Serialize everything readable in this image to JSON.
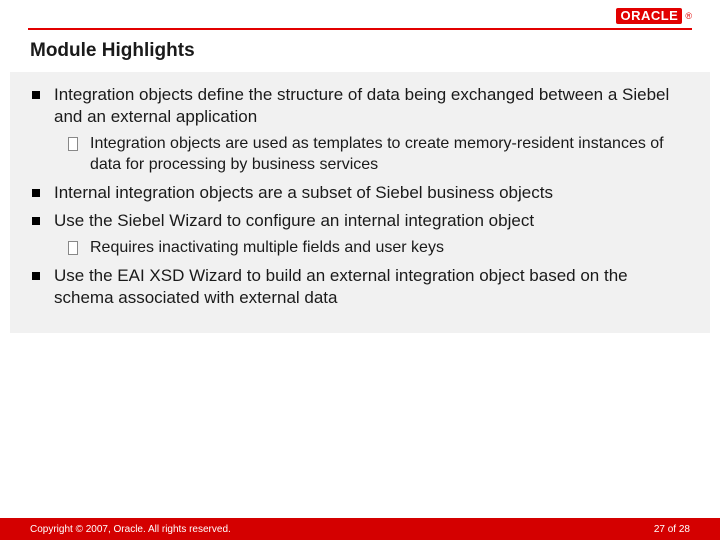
{
  "header": {
    "logo_text": "ORACLE",
    "registered": "®"
  },
  "title": "Module Highlights",
  "bullets": [
    {
      "level": 1,
      "text": "Integration objects define the structure of data being exchanged between a Siebel and an external application"
    },
    {
      "level": 2,
      "text": "Integration objects are used as templates to create memory-resident instances of data for processing by business services"
    },
    {
      "level": 1,
      "text": "Internal integration objects are a subset of Siebel business objects"
    },
    {
      "level": 1,
      "text": "Use the Siebel Wizard to configure an internal integration object"
    },
    {
      "level": 2,
      "text": "Requires inactivating multiple fields and user keys"
    },
    {
      "level": 1,
      "text": "Use the EAI XSD Wizard to build an external integration object based on the schema associated with external data"
    }
  ],
  "footer": {
    "copyright": "Copyright © 2007, Oracle. All rights reserved.",
    "page": "27 of 28"
  }
}
